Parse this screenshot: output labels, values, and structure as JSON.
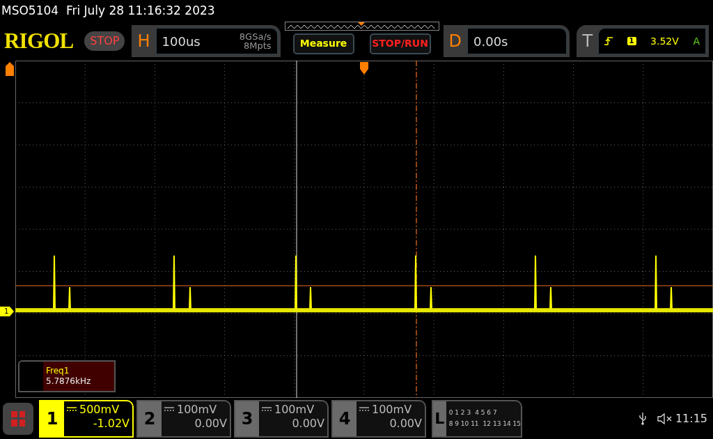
{
  "title": "MSO5104  Fri July 28 11:16:32 2023",
  "logo": "RIGOL",
  "run_state": {
    "label": "STOP",
    "kind": "stop"
  },
  "horizontal": {
    "label": "H",
    "timebase": "100us",
    "sample_rate": "8GSa/s",
    "memory": "8Mpts"
  },
  "buttons": [
    {
      "label": "Measure",
      "kind": "measure"
    },
    {
      "label": "STOP/RUN",
      "kind": "stoprun"
    }
  ],
  "delay": {
    "label": "D",
    "value": "0.00s"
  },
  "trigger": {
    "label": "T",
    "source": "1",
    "level": "3.52V",
    "mode": "A"
  },
  "channel_marker": "1",
  "measurement": {
    "name": "Freq1",
    "value": "5.7876kHz"
  },
  "channels": [
    {
      "number": "1",
      "scale": "500mV",
      "offset": "-1.02V",
      "selected": true
    },
    {
      "number": "2",
      "scale": "100mV",
      "offset": "0.00V",
      "selected": false
    },
    {
      "number": "3",
      "scale": "100mV",
      "offset": "0.00V",
      "selected": false
    },
    {
      "number": "4",
      "scale": "100mV",
      "offset": "0.00V",
      "selected": false
    }
  ],
  "logic": {
    "label": "L",
    "rows": [
      [
        "0 1 2 3",
        "4 5 6 7"
      ],
      [
        "8 9 10 11",
        "12 13 14 15"
      ]
    ]
  },
  "status": {
    "time": "11:15"
  }
}
